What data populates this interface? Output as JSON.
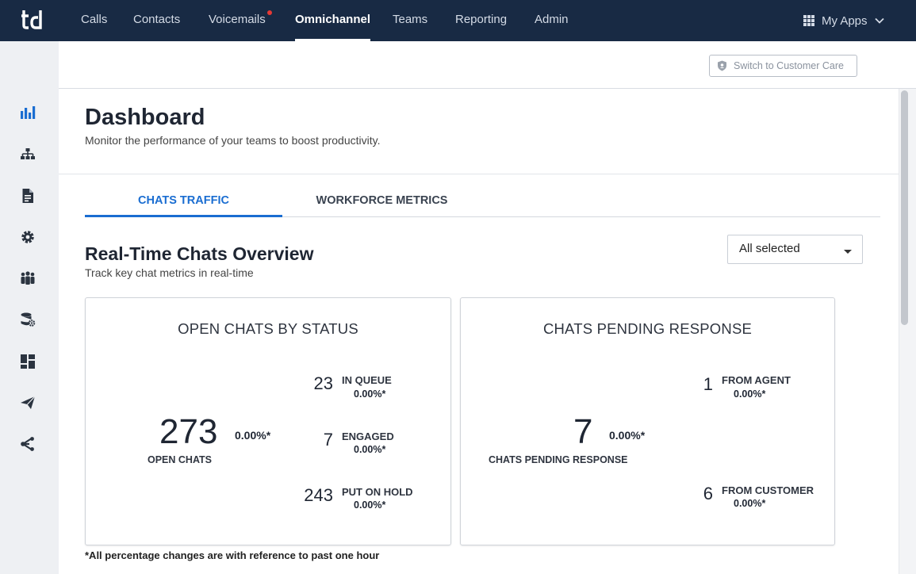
{
  "topnav": {
    "logo_text": "td",
    "items": [
      {
        "label": "Calls"
      },
      {
        "label": "Contacts"
      },
      {
        "label": "Voicemails"
      },
      {
        "label": "Omnichannel"
      },
      {
        "label": "Teams"
      },
      {
        "label": "Reporting"
      },
      {
        "label": "Admin"
      }
    ],
    "active": "Omnichannel",
    "notification_on": "Voicemails",
    "my_apps_label": "My Apps"
  },
  "sidebar": {
    "icons": [
      "bar-chart-icon",
      "org-chart-icon",
      "document-icon",
      "gear-icon",
      "people-icon",
      "database-settings-icon",
      "dashboard-icon",
      "send-icon",
      "share-icon"
    ],
    "active": "bar-chart-icon"
  },
  "header": {
    "switch_button_label": "Switch to Customer Care"
  },
  "page": {
    "title": "Dashboard",
    "subtitle": "Monitor the performance of your teams to boost productivity."
  },
  "tabs": [
    {
      "label": "CHATS TRAFFIC",
      "active": true
    },
    {
      "label": "WORKFORCE METRICS",
      "active": false
    }
  ],
  "section": {
    "title": "Real-Time Chats Overview",
    "subtitle": "Track key chat metrics in real-time",
    "filter_value": "All selected"
  },
  "cards": {
    "open_chats": {
      "title": "OPEN CHATS BY STATUS",
      "total_value": "273",
      "total_label": "OPEN CHATS",
      "total_pct": "0.00%*",
      "metrics": [
        {
          "value": "23",
          "label": "IN QUEUE",
          "pct": "0.00%*"
        },
        {
          "value": "7",
          "label": "ENGAGED",
          "pct": "0.00%*"
        },
        {
          "value": "243",
          "label": "PUT ON HOLD",
          "pct": "0.00%*"
        }
      ]
    },
    "pending": {
      "title": "CHATS PENDING RESPONSE",
      "total_value": "7",
      "total_label": "CHATS PENDING RESPONSE",
      "total_pct": "0.00%*",
      "metrics": [
        {
          "value": "1",
          "label": "FROM AGENT",
          "pct": "0.00%*"
        },
        {
          "value": "6",
          "label": "FROM CUSTOMER",
          "pct": "0.00%*"
        }
      ]
    }
  },
  "footnote": "*All percentage changes are with reference to past one hour",
  "colors": {
    "topnav_bg": "#182a44",
    "accent": "#1a6dd1",
    "notification": "#e53935"
  }
}
